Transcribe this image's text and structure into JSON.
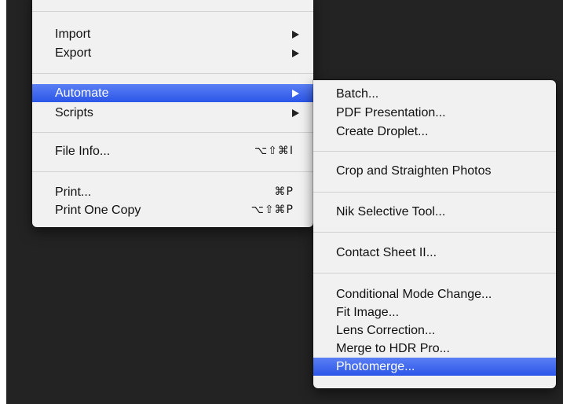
{
  "main_menu": {
    "items": [
      {
        "label": "Import",
        "has_submenu": true
      },
      {
        "label": "Export",
        "has_submenu": true
      },
      {
        "label": "Automate",
        "has_submenu": true,
        "highlighted": true
      },
      {
        "label": "Scripts",
        "has_submenu": true
      },
      {
        "label": "File Info...",
        "shortcut": "⌥⇧⌘I"
      },
      {
        "label": "Print...",
        "shortcut": "⌘P"
      },
      {
        "label": "Print One Copy",
        "shortcut": "⌥⇧⌘P"
      }
    ]
  },
  "automate_submenu": {
    "items": [
      {
        "label": "Batch..."
      },
      {
        "label": "PDF Presentation..."
      },
      {
        "label": "Create Droplet..."
      },
      {
        "label": "Crop and Straighten Photos"
      },
      {
        "label": "Nik Selective Tool..."
      },
      {
        "label": "Contact Sheet II..."
      },
      {
        "label": "Conditional Mode Change..."
      },
      {
        "label": "Fit Image..."
      },
      {
        "label": "Lens Correction..."
      },
      {
        "label": "Merge to HDR Pro..."
      },
      {
        "label": "Photomerge...",
        "highlighted": true
      }
    ]
  },
  "colors": {
    "desktop": "#232323",
    "menu_background": "#f1f1f1",
    "highlight": "#3a64ee",
    "text": "#111111"
  }
}
